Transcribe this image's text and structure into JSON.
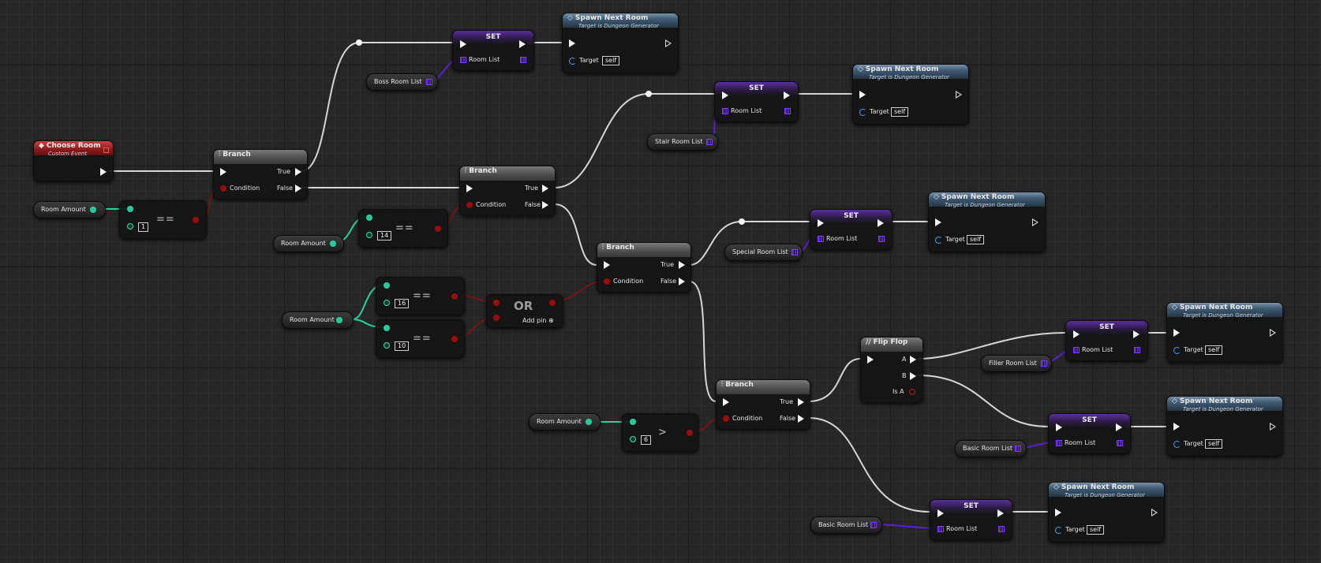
{
  "graph": {
    "event_node": {
      "title": "Choose Room",
      "subtitle": "Custom Event"
    },
    "branch_title": "Branch",
    "pins": {
      "condition": "Condition",
      "true": "True",
      "false": "False",
      "target": "Target",
      "self": "self",
      "room_list": "Room List",
      "a": "A",
      "b": "B",
      "is_a": "Is A",
      "add_pin": "Add pin"
    },
    "spawn_node": {
      "title": "Spawn Next Room",
      "subtitle": "Target is Dungeon Generator"
    },
    "set_title": "SET",
    "flip_flop_title": "Flip Flop",
    "or_title": "OR",
    "room_amount_var": "Room Amount",
    "compare_values": {
      "c1": "1",
      "c2": "14",
      "c3": "16",
      "c4": "10",
      "c5": "6"
    },
    "operators": {
      "equals": "==",
      "greater": ">"
    },
    "room_lists": {
      "boss": "Boss Room List",
      "stair": "Stair Room List",
      "special": "Special Room List",
      "filler": "Filler Room List",
      "basic1": "Basic Room List",
      "basic2": "Basic Room List"
    }
  },
  "colors": {
    "exec_wire": "#d6d6d6",
    "bool_wire": "#8e1010",
    "int_wire": "#27d4a0",
    "array_wire": "#5b1fd6",
    "spawn_header": "#3f5a74",
    "event_header": "#8b1a1a"
  }
}
